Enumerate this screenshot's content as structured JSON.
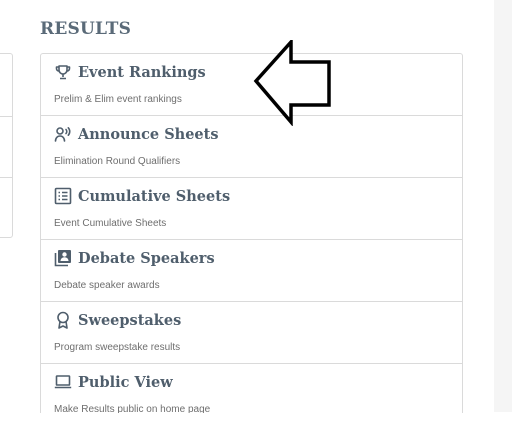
{
  "section": {
    "title": "RESULTS"
  },
  "items": [
    {
      "icon": "trophy-icon",
      "title": "Event Rankings",
      "description": "Prelim & Elim event rankings"
    },
    {
      "icon": "announce-icon",
      "title": "Announce Sheets",
      "description": "Elimination Round Qualifiers"
    },
    {
      "icon": "list-icon",
      "title": "Cumulative Sheets",
      "description": "Event Cumulative Sheets"
    },
    {
      "icon": "speaker-badge-icon",
      "title": "Debate Speakers",
      "description": "Debate speaker awards"
    },
    {
      "icon": "award-ribbon-icon",
      "title": "Sweepstakes",
      "description": "Program sweepstake results"
    },
    {
      "icon": "laptop-icon",
      "title": "Public View",
      "description": "Make Results public on home page"
    }
  ],
  "colors": {
    "title": "#4f5e6c",
    "border": "#dadada",
    "description": "#6e6e6e"
  },
  "annotation": {
    "icon": "left-arrow-icon",
    "points_to": "Event Rankings"
  }
}
